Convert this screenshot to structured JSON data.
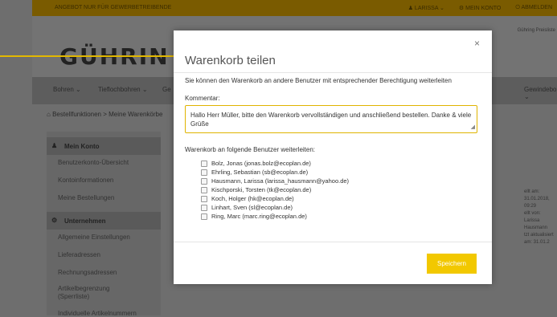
{
  "topbar": {
    "notice": "ANGEBOT NUR FÜR GEWERBETREIBENDE",
    "user": "LARISSA",
    "account": "MEIN KONTO",
    "logout": "ABMELDEN"
  },
  "header": {
    "logo_text": "GÜHRIN",
    "price_note": "Gühring Preisliste"
  },
  "nav": {
    "items": [
      "Bohren ⌄",
      "Tieflochbohren ⌄",
      "Ge",
      "Gewindebohren ⌄"
    ]
  },
  "breadcrumb": "Bestellfunktionen > Meine Warenkörbe",
  "sidebar": {
    "section1": "Mein Konto",
    "items1": [
      "Benutzerkonto-Übersicht",
      "Kontoinformationen",
      "Meine Bestellungen"
    ],
    "section2": "Unternehmen",
    "items2": [
      "Allgemeine Einstellungen",
      "Lieferadressen",
      "Rechnungsadressen",
      "Artikelbegrenzung",
      "(Sperrliste)",
      "Individuelle Artikelnummern"
    ]
  },
  "right_info": {
    "line1": "ellt am: 31.01.2018, 09:29",
    "line2": "ellt von: Larissa Hausmann",
    "line3": "tzt aktualisiert am: 31.01.2"
  },
  "modal": {
    "title": "Warenkorb teilen",
    "description": "Sie können den Warenkorb an andere Benutzer mit entsprechender Berechtigung weiterleiten",
    "comment_label": "Kommentar:",
    "comment_text": "Hallo Herr Müller, bitte den Warenkorb vervollständigen und anschließend bestellen. Danke & viele Grüße",
    "users_label": "Warenkorb an folgende Benutzer weiterleiten:",
    "users": [
      "Bolz, Jonas (jonas.bolz@ecoplan.de)",
      "Ehrling, Sebastian (sb@ecoplan.de)",
      "Hausmann, Larissa (larissa_hausmann@yahoo.de)",
      "Kischporski, Torsten (tk@ecoplan.de)",
      "Koch, Holger (hk@ecoplan.de)",
      "Linhart, Sven (sl@ecoplan.de)",
      "Ring, Marc (marc.ring@ecoplan.de)"
    ],
    "save_label": "Speichern",
    "close_symbol": "×"
  },
  "colors": {
    "accent": "#f2c800",
    "overlay": "#6e6e6e"
  }
}
